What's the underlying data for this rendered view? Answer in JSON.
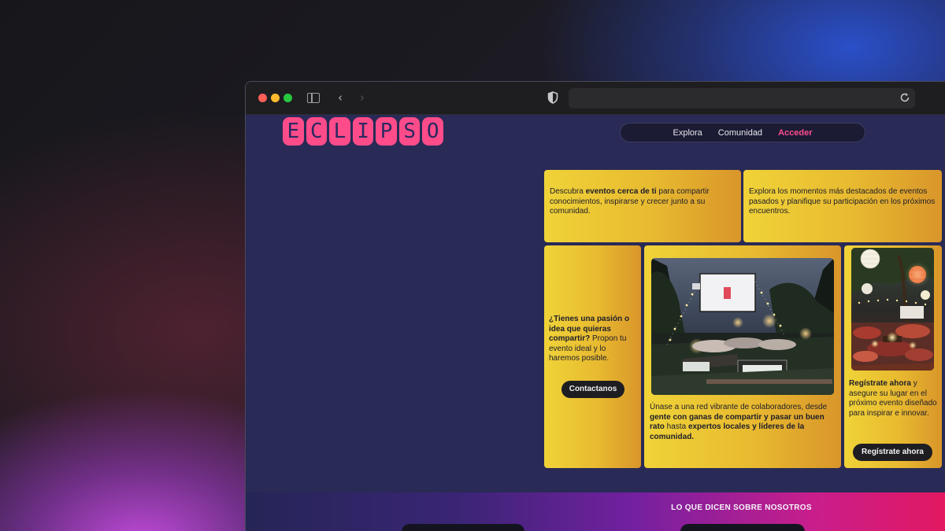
{
  "brand": {
    "logo_letters": [
      "E",
      "C",
      "L",
      "I",
      "P",
      "S",
      "O"
    ],
    "logo_color": "#fe4c8a"
  },
  "nav": {
    "items": [
      {
        "label": "Explora",
        "active": false
      },
      {
        "label": "Comunidad",
        "active": false
      },
      {
        "label": "Acceder",
        "active": true
      }
    ],
    "active_color": "#ff4c8c"
  },
  "cards": {
    "events_near": {
      "pre": "Descubra ",
      "bold": "eventos cerca de ti",
      "post": " para compartir conocimientos, inspirarse y crecer junto a su comunidad."
    },
    "highlights": {
      "text": "Explora los momentos más destacados de eventos pasados y planifique su participación en los próximos encuentros."
    },
    "passion": {
      "bold": "¿Tienes una pasión o idea que quieras compartir?",
      "post": " Propon tu evento ideal y lo haremos posible.",
      "button_label": "Contactanos"
    },
    "network": {
      "pre": "Únase a una red vibrante de colaboradores, desde ",
      "bold1": "gente con ganas de compartir y pasar un buen rato",
      "mid": " hasta ",
      "bold2": "expertos locales y líderes de la comunidad."
    },
    "register": {
      "bold": "Regístrate ahora",
      "post": " y asegure su lugar en el próximo evento diseñado para inspirar e innovar.",
      "button_label": "Regístrate ahora"
    }
  },
  "testimonials": {
    "title": "LO QUE DICEN SOBRE NOSOTROS"
  },
  "colors": {
    "page_bg": "#292a56",
    "card_gradient_start": "#f0d338",
    "card_gradient_end": "#d9962a"
  }
}
